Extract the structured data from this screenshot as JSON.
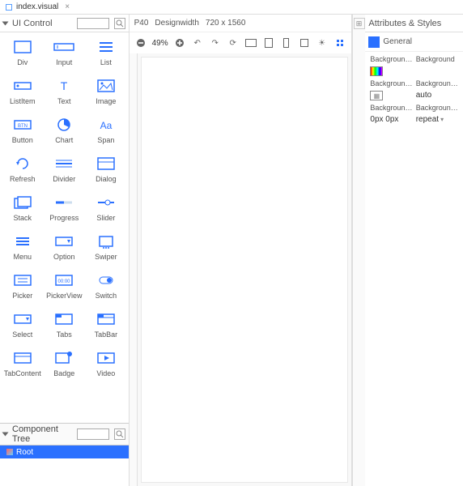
{
  "tab": {
    "title": "index.visual"
  },
  "left": {
    "title": "UI Control",
    "components": [
      "Div",
      "Input",
      "List",
      "ListItem",
      "Text",
      "Image",
      "Button",
      "Chart",
      "Span",
      "Refresh",
      "Divider",
      "Dialog",
      "Stack",
      "Progress",
      "Slider",
      "Menu",
      "Option",
      "Swiper",
      "Picker",
      "PickerView",
      "Switch",
      "Select",
      "Tabs",
      "TabBar",
      "TabContent",
      "Badge",
      "Video"
    ],
    "tree_title": "Component Tree",
    "tree_root": "Root"
  },
  "center": {
    "device": "P40",
    "design_label": "Designwidth",
    "resolution": "720 x 1560",
    "zoom": "49%"
  },
  "right": {
    "title": "Attributes & Styles",
    "section": "General",
    "props": [
      {
        "l": "Background...",
        "r": "Background",
        "vtype": "swatch"
      },
      {
        "l": "Background...",
        "r": "Background...",
        "vtype": "rect",
        "rv": "auto"
      },
      {
        "l": "Background...",
        "r": "Background...",
        "lv": "0px 0px",
        "rv": "repeat",
        "dd": true
      }
    ]
  }
}
